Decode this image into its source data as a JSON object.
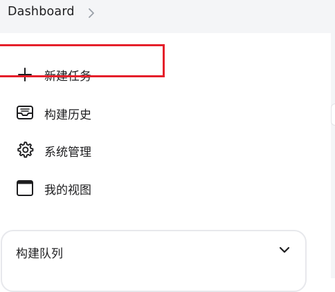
{
  "breadcrumb": {
    "root_label": "Dashboard",
    "separator_icon": "chevron-right-icon"
  },
  "sidebar": {
    "items": [
      {
        "label": "新建任务",
        "icon": "plus-icon"
      },
      {
        "label": "构建历史",
        "icon": "inbox-tray-icon"
      },
      {
        "label": "系统管理",
        "icon": "gear-icon"
      },
      {
        "label": "我的视图",
        "icon": "window-icon"
      }
    ]
  },
  "build_queue": {
    "title": "构建队列",
    "toggle_icon": "chevron-down-icon"
  },
  "colors": {
    "topbar_bg": "#f4f5f7",
    "highlight_border": "#e51f2a",
    "text": "#1d1d1f",
    "panel_border": "#e7e8ec"
  }
}
